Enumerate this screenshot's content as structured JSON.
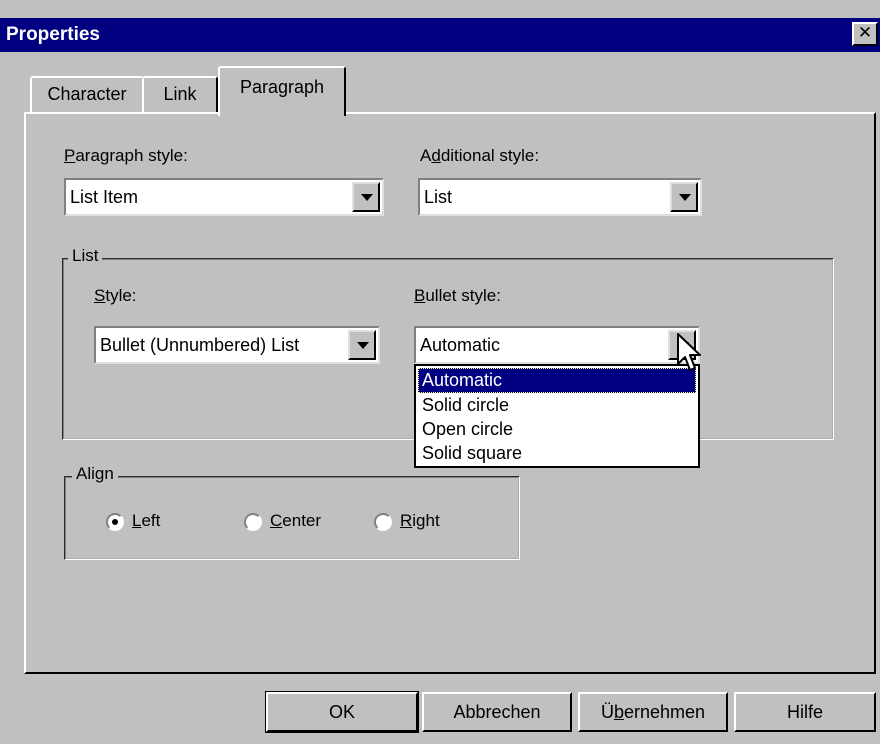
{
  "window": {
    "title": "Properties",
    "close_glyph": "✕"
  },
  "tabs": [
    {
      "label": "Character",
      "active": false
    },
    {
      "label": "Link",
      "active": false
    },
    {
      "label": "Paragraph",
      "active": true
    }
  ],
  "paragraph_style": {
    "label_pre": "",
    "label_mn": "P",
    "label_post": "aragraph style:",
    "value": "List Item"
  },
  "additional_style": {
    "label_pre": "A",
    "label_mn": "d",
    "label_post": "ditional style:",
    "value": "List"
  },
  "list_group": {
    "legend": "List",
    "style": {
      "label_mn": "S",
      "label_post": "tyle:",
      "value": "Bullet (Unnumbered) List"
    },
    "bullet_style": {
      "label_mn": "B",
      "label_post": "ullet style:",
      "value": "Automatic",
      "options": [
        "Automatic",
        "Solid circle",
        "Open circle",
        "Solid square"
      ],
      "selected_index": 0
    }
  },
  "align_group": {
    "legend": "Align",
    "options": [
      {
        "mn": "L",
        "rest": "eft",
        "checked": true
      },
      {
        "mn": "C",
        "rest": "enter",
        "checked": false
      },
      {
        "mn": "R",
        "rest": "ight",
        "checked": false
      }
    ]
  },
  "buttons": {
    "ok": "OK",
    "cancel": "Abbrechen",
    "apply_pre": "Ü",
    "apply_mn": "b",
    "apply_post": "ernehmen",
    "help": "Hilfe"
  },
  "icons": {
    "cursor": "mouse-pointer-icon",
    "close": "close-icon",
    "dropdown": "chevron-down-icon"
  },
  "colors": {
    "titlebar": "#000080",
    "face": "#c0c0c0",
    "selection": "#000080"
  }
}
